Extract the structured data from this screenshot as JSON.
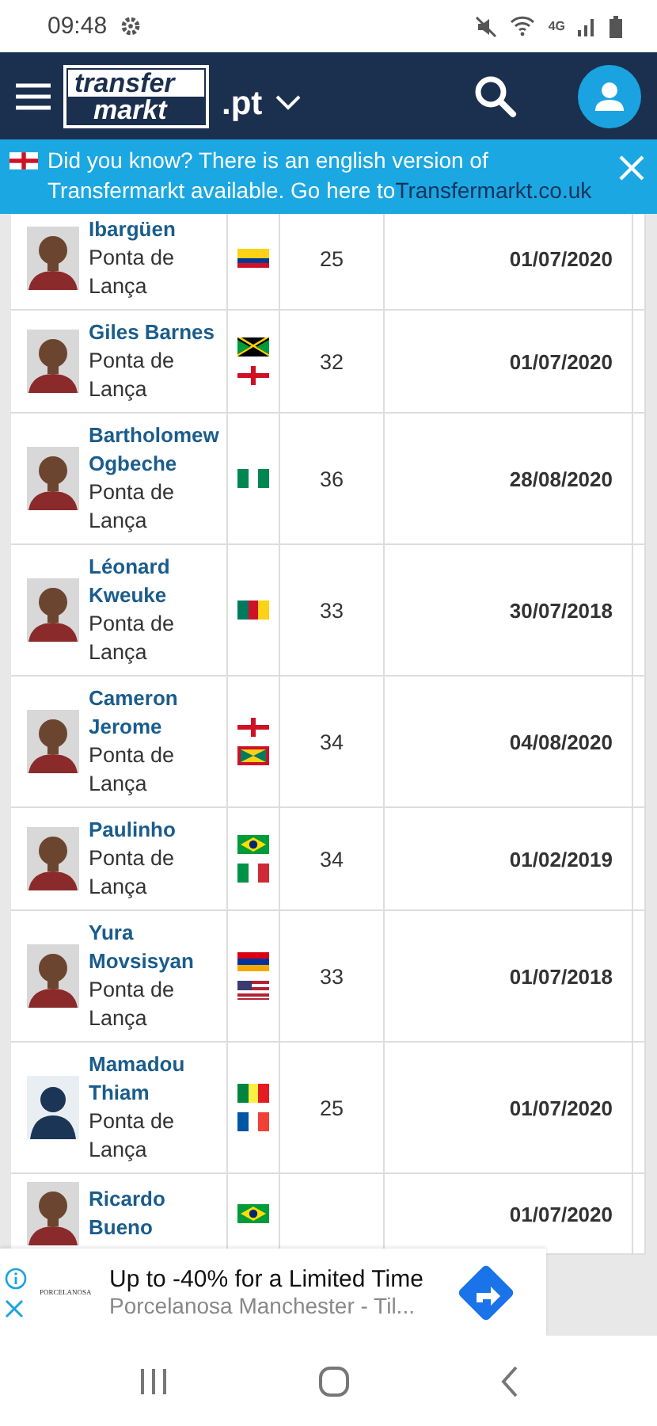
{
  "status_bar": {
    "time": "09:48",
    "network": "4G"
  },
  "header": {
    "logo_top": "transfer",
    "logo_bottom": "markt",
    "domain": ".pt"
  },
  "banner": {
    "text": "Did you know? There is an english version of Transfermarkt available. Go here to",
    "link": "Transfermarkt.co.uk"
  },
  "table": {
    "rows": [
      {
        "name": "Ibargüen",
        "position": "Ponta de Lança",
        "flags": [
          {
            "kind": "co"
          }
        ],
        "age": "25",
        "date": "01/07/2020",
        "photo": {
          "kind": "picture"
        }
      },
      {
        "name": "Giles Barnes",
        "position": "Ponta de Lança",
        "flags": [
          {
            "kind": "jm"
          },
          {
            "kind": "en"
          }
        ],
        "age": "32",
        "date": "01/07/2020",
        "photo": {
          "kind": "picture"
        }
      },
      {
        "name": "Bartholomew Ogbeche",
        "position": "Ponta de Lança",
        "flags": [
          {
            "kind": "ng"
          }
        ],
        "age": "36",
        "date": "28/08/2020",
        "photo": {
          "kind": "picture"
        }
      },
      {
        "name": "Léonard Kweuke",
        "position": "Ponta de Lança",
        "flags": [
          {
            "kind": "cm"
          }
        ],
        "age": "33",
        "date": "30/07/2018",
        "photo": {
          "kind": "picture"
        }
      },
      {
        "name": "Cameron Jerome",
        "position": "Ponta de Lança",
        "flags": [
          {
            "kind": "en"
          },
          {
            "kind": "gd"
          }
        ],
        "age": "34",
        "date": "04/08/2020",
        "photo": {
          "kind": "picture"
        }
      },
      {
        "name": "Paulinho",
        "position": "Ponta de Lança",
        "flags": [
          {
            "kind": "br"
          },
          {
            "kind": "it"
          }
        ],
        "age": "34",
        "date": "01/02/2019",
        "photo": {
          "kind": "picture"
        }
      },
      {
        "name": "Yura Movsisyan",
        "position": "Ponta de Lança",
        "flags": [
          {
            "kind": "am"
          },
          {
            "kind": "us"
          }
        ],
        "age": "33",
        "date": "01/07/2018",
        "photo": {
          "kind": "picture"
        }
      },
      {
        "name": "Mamadou Thiam",
        "position": "Ponta de Lança",
        "flags": [
          {
            "kind": "sn"
          },
          {
            "kind": "fr"
          }
        ],
        "age": "25",
        "date": "01/07/2020",
        "photo": {
          "kind": "silhouette"
        }
      },
      {
        "name": "Ricardo Bueno",
        "flags": [
          {
            "kind": "br"
          }
        ],
        "date": "01/07/2020",
        "photo": {
          "kind": "picture"
        }
      }
    ]
  },
  "ad": {
    "brand": "PORCELANOSA",
    "headline": "Up to -40% for a Limited Time",
    "subtitle": "Porcelanosa Manchester - Til..."
  }
}
